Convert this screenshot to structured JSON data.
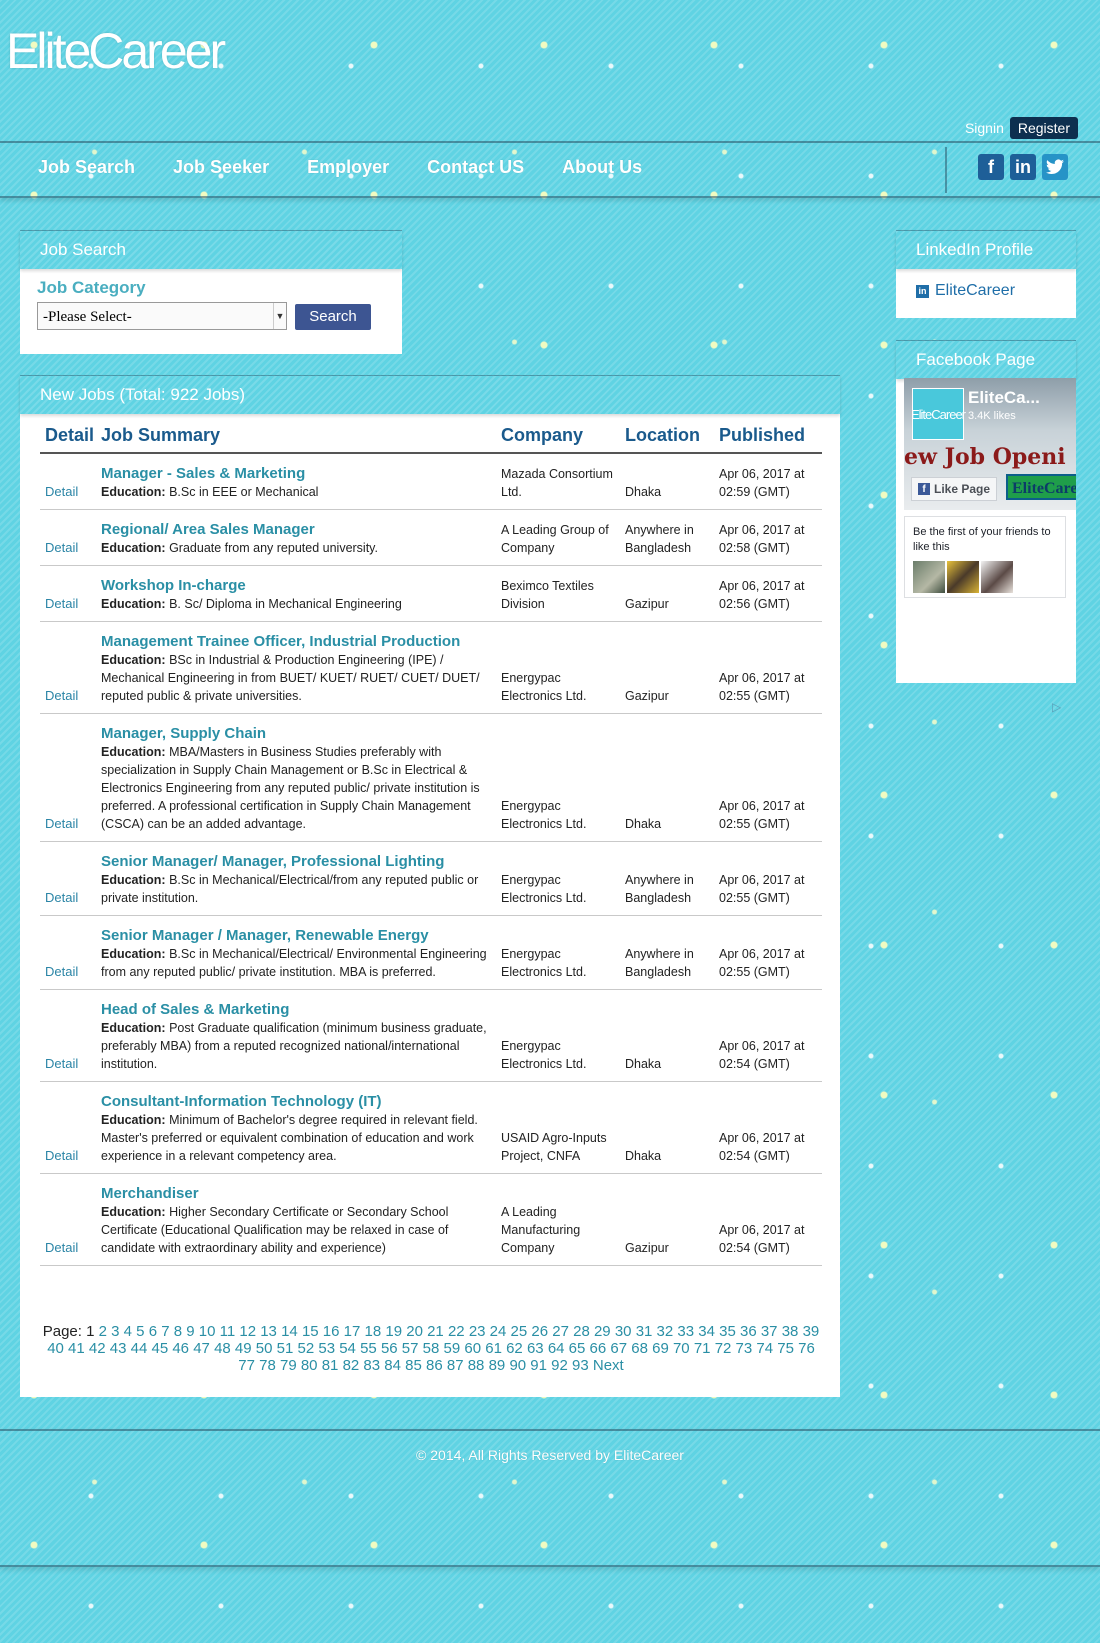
{
  "header": {
    "logo": "EliteCareer",
    "signin": "Signin",
    "register": "Register"
  },
  "nav": {
    "items": [
      "Job Search",
      "Job Seeker",
      "Employer",
      "Contact US",
      "About Us"
    ],
    "social": [
      {
        "icon": "facebook-icon",
        "glyph": "f"
      },
      {
        "icon": "linkedin-icon",
        "glyph": "in"
      },
      {
        "icon": "twitter-icon",
        "glyph": "t"
      }
    ]
  },
  "job_search": {
    "title": "Job Search",
    "category_label": "Job Category",
    "select_value": "-Please Select-",
    "search_button": "Search"
  },
  "new_jobs": {
    "title": "New Jobs (Total: 922 Jobs)",
    "headers": {
      "detail": "Detail",
      "summary": "Job Summary",
      "company": "Company",
      "location": "Location",
      "published": "Published"
    },
    "detail_label": "Detail",
    "education_label": "Education:",
    "rows": [
      {
        "title": "Manager - Sales & Marketing",
        "education": "B.Sc in EEE or Mechanical",
        "company": "Mazada Consortium Ltd.",
        "location": "Dhaka",
        "published": "Apr 06, 2017 at 02:59 (GMT)"
      },
      {
        "title": "Regional/ Area Sales Manager",
        "education": "Graduate from any reputed university.",
        "company": "A Leading Group of Company",
        "location": "Anywhere in Bangladesh",
        "published": "Apr 06, 2017 at 02:58 (GMT)"
      },
      {
        "title": "Workshop In-charge",
        "education": "B. Sc/ Diploma in Mechanical Engineering",
        "company": "Beximco Textiles Division",
        "location": "Gazipur",
        "published": "Apr 06, 2017 at 02:56 (GMT)"
      },
      {
        "title": "Management Trainee Officer, Industrial Production",
        "education": "BSc in Industrial & Production Engineering (IPE) / Mechanical Engineering in from BUET/ KUET/ RUET/ CUET/ DUET/ reputed public & private universities.",
        "company": "Energypac Electronics Ltd.",
        "location": "Gazipur",
        "published": "Apr 06, 2017 at 02:55 (GMT)"
      },
      {
        "title": "Manager, Supply Chain",
        "education": "MBA/Masters in Business Studies preferably with specialization in Supply Chain Management or B.Sc in Electrical & Electronics Engineering from any reputed public/ private institution is preferred. A professional certification in Supply Chain Management (CSCA) can be an added advantage.",
        "company": "Energypac Electronics Ltd.",
        "location": "Dhaka",
        "published": "Apr 06, 2017 at 02:55 (GMT)"
      },
      {
        "title": "Senior Manager/ Manager, Professional Lighting",
        "education": "B.Sc in Mechanical/Electrical/from any reputed public or private institution.",
        "company": "Energypac Electronics Ltd.",
        "location": "Anywhere in Bangladesh",
        "published": "Apr 06, 2017 at 02:55 (GMT)"
      },
      {
        "title": "Senior Manager / Manager, Renewable Energy",
        "education": "B.Sc in Mechanical/Electrical/ Environmental Engineering from any reputed public/ private institution. MBA is preferred.",
        "company": "Energypac Electronics Ltd.",
        "location": "Anywhere in Bangladesh",
        "published": "Apr 06, 2017 at 02:55 (GMT)"
      },
      {
        "title": "Head of Sales & Marketing",
        "education": "Post Graduate qualification (minimum business graduate, preferably MBA) from a reputed recognized national/international institution.",
        "company": "Energypac Electronics Ltd.",
        "location": "Dhaka",
        "published": "Apr 06, 2017 at 02:54 (GMT)"
      },
      {
        "title": "Consultant-Information Technology (IT)",
        "education": "Minimum of Bachelor's degree required in relevant field. Master's preferred or equivalent combination of education and work experience in a relevant competency area.",
        "company": "USAID Agro-Inputs Project, CNFA",
        "location": "Dhaka",
        "published": "Apr 06, 2017 at 02:54 (GMT)"
      },
      {
        "title": "Merchandiser",
        "education": "Higher Secondary Certificate or Secondary School Certificate (Educational Qualification may be relaxed in case of candidate with extraordinary ability and experience)",
        "company": "A Leading Manufacturing Company",
        "location": "Gazipur",
        "published": "Apr 06, 2017 at 02:54 (GMT)"
      }
    ],
    "pager": {
      "label": "Page:",
      "current": "1",
      "first": 1,
      "last": 93,
      "next": "Next"
    }
  },
  "linkedin": {
    "title": "LinkedIn Profile",
    "link": "EliteCareer"
  },
  "facebook": {
    "title": "Facebook Page",
    "page_name": "EliteCa...",
    "likes": "3.4K likes",
    "logo_text": "EliteCareer",
    "banner": "ew Job Openi",
    "like_button": "Like Page",
    "brand": "EliteCareer",
    "friends_text": "Be the first of your friends to like this"
  },
  "footer": {
    "text": "© 2014, All Rights Reserved by EliteCareer"
  },
  "colors": {
    "background": "#5fd3e3",
    "title_link": "#2a8fa5",
    "header_text": "#1a5a8c",
    "button": "#3d5592"
  }
}
